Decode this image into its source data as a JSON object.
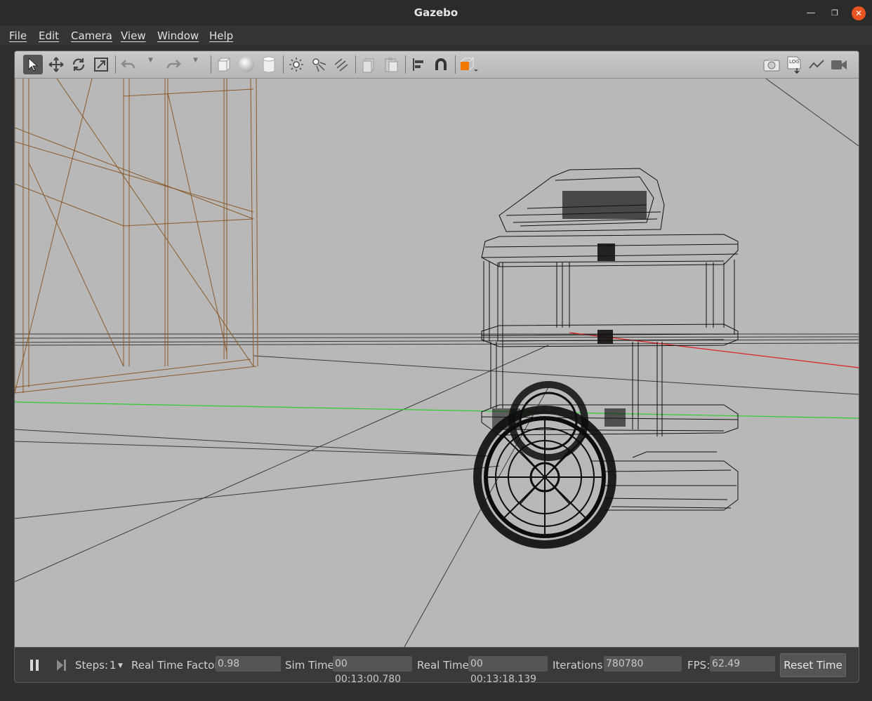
{
  "window": {
    "title": "Gazebo"
  },
  "menu": {
    "items": [
      "File",
      "Edit",
      "Camera",
      "View",
      "Window",
      "Help"
    ]
  },
  "toolbar": {
    "icons": [
      "select-arrow-icon",
      "translate-icon",
      "rotate-icon",
      "scale-icon",
      "undo-icon",
      "redo-icon",
      "box-icon",
      "sphere-icon",
      "cylinder-icon",
      "point-light-icon",
      "spot-light-icon",
      "directional-light-icon",
      "copy-icon",
      "paste-icon",
      "align-icon",
      "magnet-icon",
      "view-angle-icon",
      "screenshot-icon",
      "log-icon",
      "plot-icon",
      "record-video-icon"
    ],
    "log_label": "LOG"
  },
  "status": {
    "steps_label": "Steps:",
    "steps_value": "1",
    "rtf_label": "Real Time Factor:",
    "rtf_value": "0.98",
    "sim_time_label": "Sim Time:",
    "sim_time_value": "00 00:13:00.780",
    "real_time_label": "Real Time:",
    "real_time_value": "00 00:13:18.139",
    "iterations_label": "Iterations:",
    "iterations_value": "780780",
    "fps_label": "FPS:",
    "fps_value": "62.49",
    "reset_label": "Reset Time"
  },
  "colors": {
    "accent": "#e95420",
    "orange_box": "#f07800",
    "grid_green": "#2ecc2e",
    "axis_red": "#e02020",
    "wall_brown": "#8b5a2b"
  }
}
